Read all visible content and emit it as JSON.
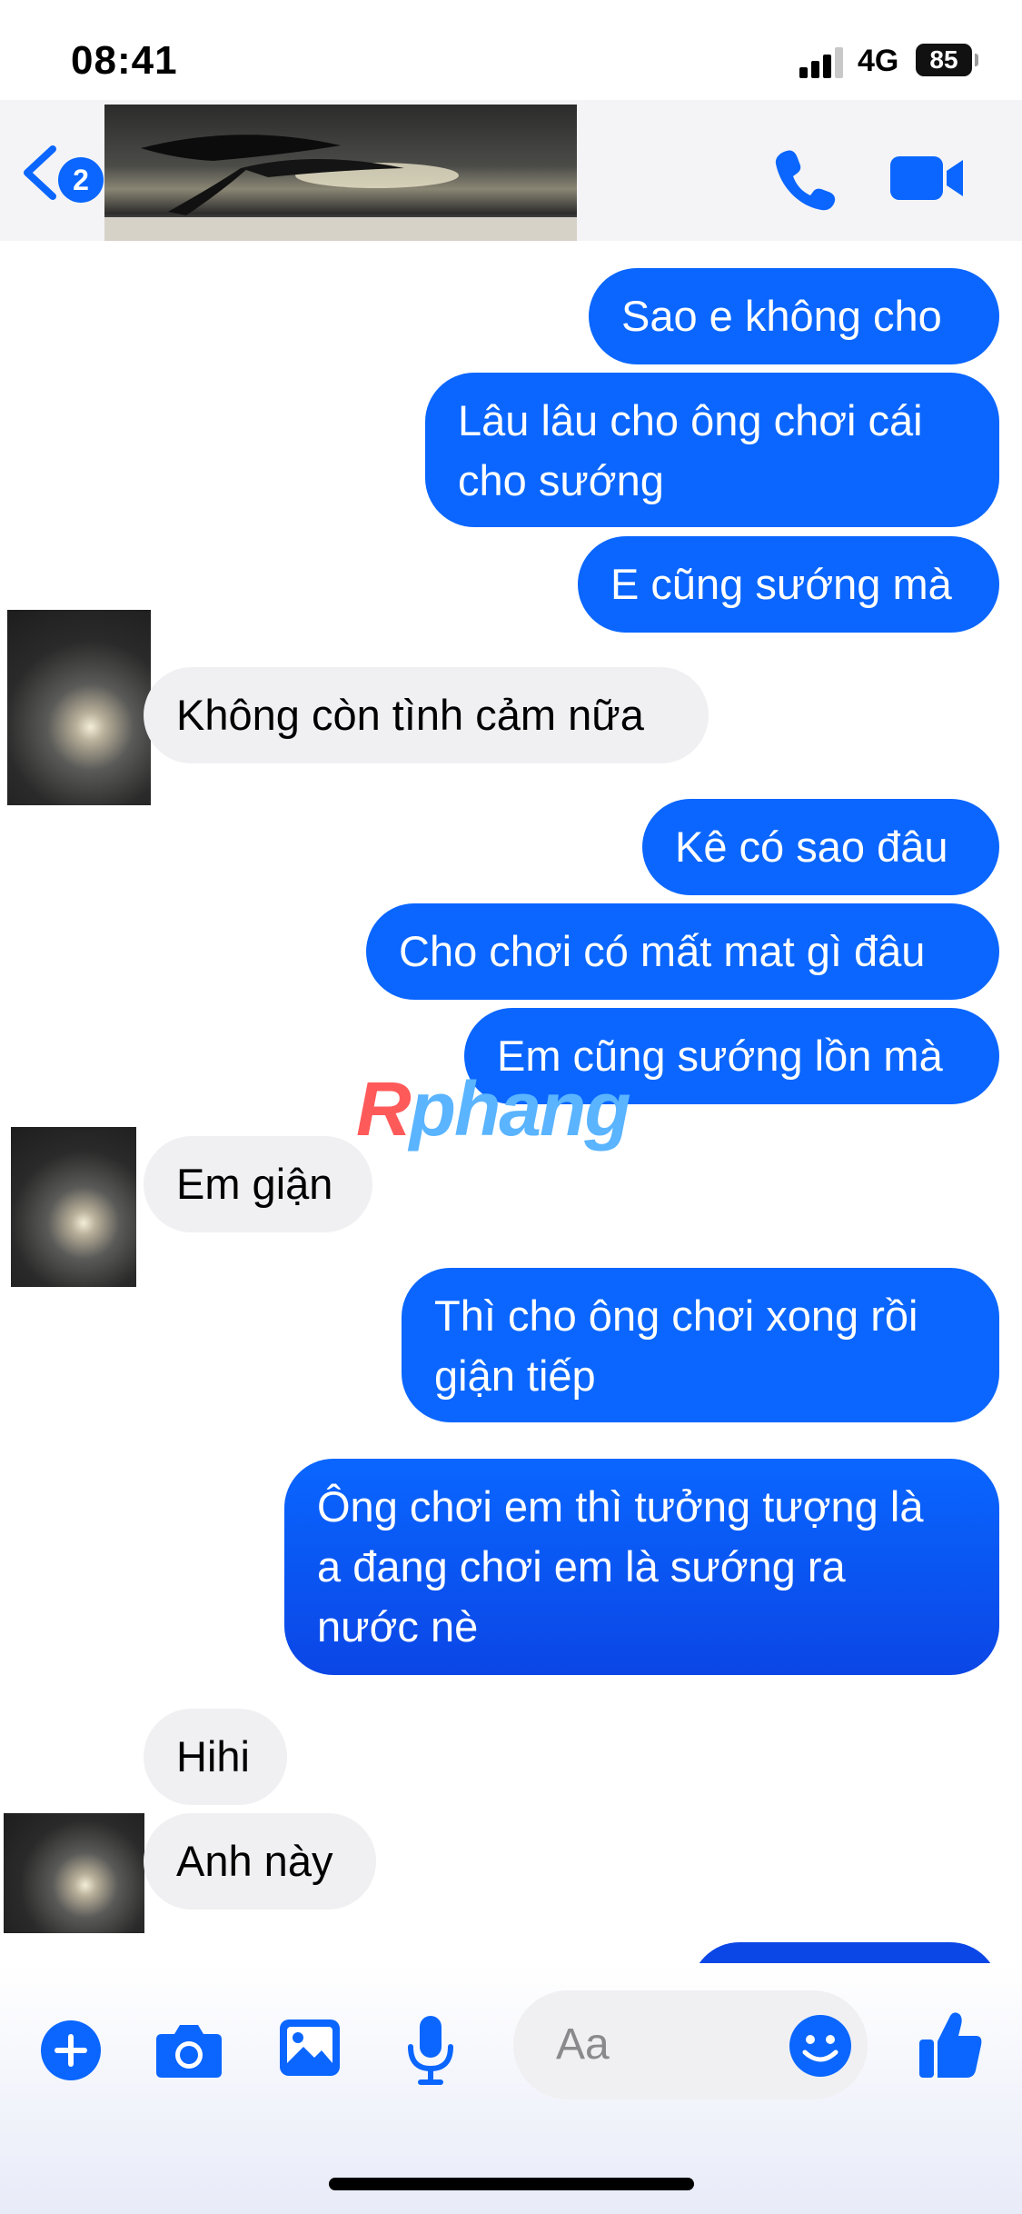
{
  "status_bar": {
    "time": "08:41",
    "network": "4G",
    "battery": "85"
  },
  "header": {
    "unread_count": "2"
  },
  "watermark": {
    "first": "R",
    "rest": "phang"
  },
  "messages": [
    {
      "side": "out",
      "text": "Sao e không cho"
    },
    {
      "side": "out",
      "text": "Lâu lâu cho ông chơi cái\ncho sướng"
    },
    {
      "side": "out",
      "text": "E cũng sướng mà"
    },
    {
      "side": "in",
      "text": "Không còn tình cảm nữa"
    },
    {
      "side": "out",
      "text": "Kê có sao đâu"
    },
    {
      "side": "out",
      "text": "Cho chơi có mất mat gì đâu"
    },
    {
      "side": "out",
      "text": "Em cũng sướng lồn mà"
    },
    {
      "side": "in",
      "text": "Em giận"
    },
    {
      "side": "out",
      "text": "Thì cho ông chơi xong rồi\ngiận tiếp"
    },
    {
      "side": "out",
      "text": "Ông chơi em thì tưởng tượng là\na đang chơi em là sướng ra\nnước nè"
    },
    {
      "side": "in",
      "text": "Hihi"
    },
    {
      "side": "in",
      "text": "Anh này"
    }
  ],
  "composer": {
    "placeholder": "Aa"
  },
  "colors": {
    "accent": "#0a66ff",
    "incoming_bubble": "#f0f0f2"
  },
  "icons": [
    "chevron-left-icon",
    "phone-icon",
    "video-camera-icon",
    "plus-icon",
    "camera-icon",
    "image-icon",
    "microphone-icon",
    "emoji-icon",
    "thumbs-up-icon"
  ]
}
